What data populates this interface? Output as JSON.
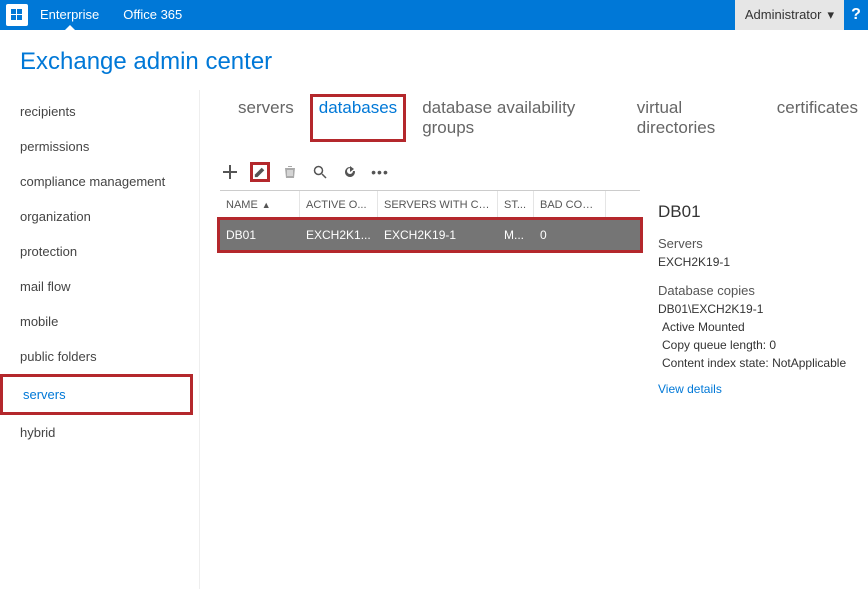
{
  "topbar": {
    "items": [
      "Enterprise",
      "Office 365"
    ],
    "admin_label": "Administrator",
    "help": "?"
  },
  "page_title": "Exchange admin center",
  "sidebar": {
    "items": [
      {
        "label": "recipients"
      },
      {
        "label": "permissions"
      },
      {
        "label": "compliance management"
      },
      {
        "label": "organization"
      },
      {
        "label": "protection"
      },
      {
        "label": "mail flow"
      },
      {
        "label": "mobile"
      },
      {
        "label": "public folders"
      },
      {
        "label": "servers",
        "active": true
      },
      {
        "label": "hybrid"
      }
    ]
  },
  "tabs": [
    {
      "label": "servers"
    },
    {
      "label": "databases",
      "active": true
    },
    {
      "label": "database availability groups"
    },
    {
      "label": "virtual directories"
    },
    {
      "label": "certificates"
    }
  ],
  "toolbar": {
    "add": "add",
    "edit": "edit",
    "delete": "delete",
    "search": "search",
    "refresh": "refresh",
    "more": "more"
  },
  "grid": {
    "columns": [
      {
        "label": "NAME",
        "sorted": true
      },
      {
        "label": "ACTIVE O..."
      },
      {
        "label": "SERVERS WITH CO..."
      },
      {
        "label": "ST..."
      },
      {
        "label": "BAD COPY..."
      }
    ],
    "rows": [
      {
        "name": "DB01",
        "active_on": "EXCH2K1...",
        "servers": "EXCH2K19-1",
        "status": "M...",
        "bad": "0"
      }
    ]
  },
  "details": {
    "title": "DB01",
    "servers_label": "Servers",
    "servers_value": "EXCH2K19-1",
    "copies_label": "Database copies",
    "copy_path": "DB01\\EXCH2K19-1",
    "copy_status": "Active Mounted",
    "copy_queue": "Copy queue length: 0",
    "copy_index": "Content index state: NotApplicable",
    "view_details": "View details"
  }
}
